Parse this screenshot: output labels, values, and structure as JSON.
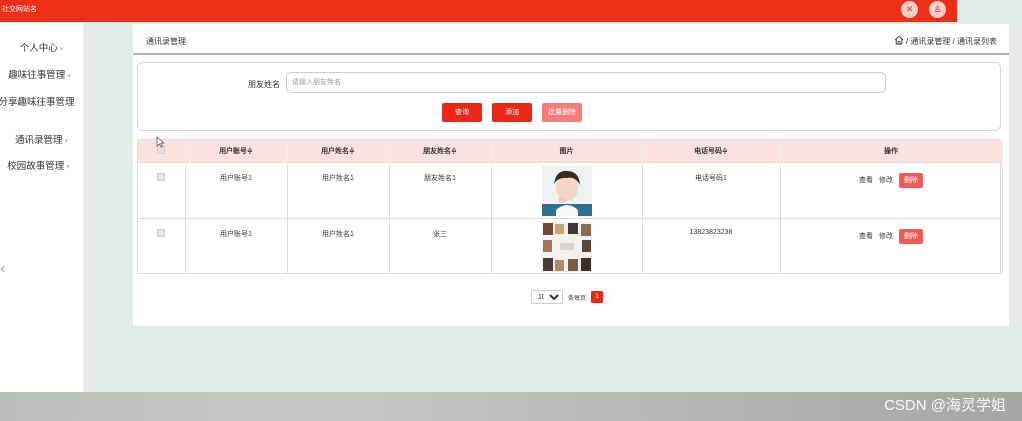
{
  "header": {
    "site_title": "社交网站名",
    "close_glyph": "✕",
    "user_glyph": "♙"
  },
  "sidebar": {
    "items": [
      {
        "label": "个人中心"
      },
      {
        "label": "趣味往事管理"
      },
      {
        "label": "分享趣味往事管理"
      },
      {
        "label": "通讯录管理"
      },
      {
        "label": "校园故事管理"
      }
    ],
    "arrow": "▾",
    "collapse_glyph": "‹"
  },
  "page": {
    "title": "通讯录管理",
    "breadcrumb": "/ 通讯录管理 / 通讯录列表"
  },
  "search": {
    "label": "朋友姓名",
    "placeholder": "请输入朋友姓名",
    "value": "",
    "query_label": "查询",
    "add_label": "添加",
    "batch_delete_label": "批量删除"
  },
  "table": {
    "columns": [
      "用户账号≑",
      "用户姓名≑",
      "朋友姓名≑",
      "图片",
      "电话号码≑",
      "操作"
    ],
    "rows": [
      {
        "user_account": "用户账号1",
        "user_name": "用户姓名1",
        "friend_name": "朋友姓名1",
        "phone": "电话号码1",
        "image": "portrait-photo"
      },
      {
        "user_account": "用户账号1",
        "user_name": "用户姓名1",
        "friend_name": "张三",
        "phone": "13823823238",
        "image": "collage-photo"
      }
    ],
    "actions": {
      "view": "查看",
      "edit": "修改",
      "delete": "删除"
    }
  },
  "pagination": {
    "page_size": "10",
    "per_page_label": "条每页",
    "current_page": "1"
  },
  "watermark": "CSDN @海灵学姐",
  "colors": {
    "accent": "#ee2e17",
    "button_red": "#e9281a",
    "batch_delete": "#f97b78",
    "header_row": "#fbe2df",
    "background": "#e4ece8"
  }
}
